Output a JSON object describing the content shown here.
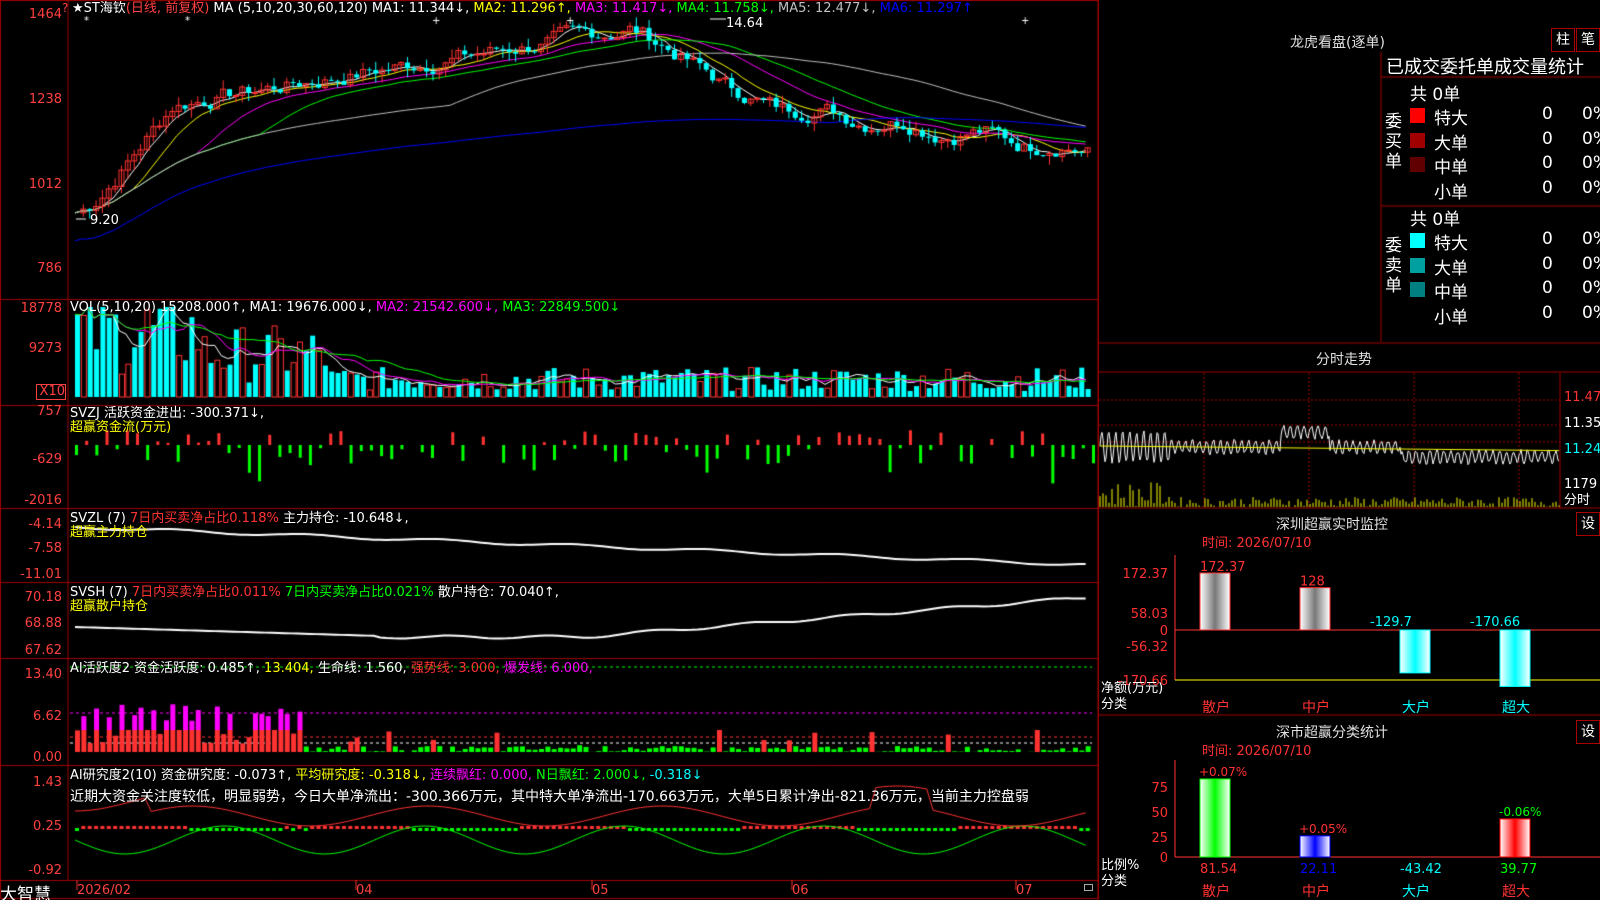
{
  "app": {
    "name": "大智慧"
  },
  "colors": {
    "up": "#ff3232",
    "down": "#00ffff",
    "grid": "#a00000",
    "yellow": "#ffff00",
    "magenta": "#ff00ff",
    "green": "#00ff00",
    "white": "#ffffff",
    "blue": "#0000ff",
    "gray": "#c0c0c0"
  },
  "main": {
    "stock_label": "ST海钦",
    "mode": "(日线, 前复权)",
    "ma_params": "MA (5,10,20,30,60,120)",
    "ma_values": [
      {
        "t": "MA1: 11.344↓,",
        "c": "#ffffff"
      },
      {
        "t": "MA2: 11.296↑,",
        "c": "#ffff00"
      },
      {
        "t": "MA3: 11.417↓,",
        "c": "#ff00ff"
      },
      {
        "t": "MA4: 11.758↓,",
        "c": "#00ff00"
      },
      {
        "t": "MA5: 12.477↓,",
        "c": "#c0c0c0"
      },
      {
        "t": "MA6: 11.297↑",
        "c": "#0000ff"
      }
    ],
    "yticks": [
      "1464",
      "1238",
      "1012",
      "786"
    ],
    "high_marker": "14.64",
    "low_marker": "9.20",
    "corner": "?",
    "date_axis": [
      "2026/02",
      "04",
      "05",
      "06",
      "07"
    ]
  },
  "vol": {
    "title": "VOL(5,10,20)",
    "value": "15208.000↑,",
    "mas": [
      {
        "t": "MA1: 19676.000↓,",
        "c": "#ffffff"
      },
      {
        "t": "MA2: 21542.600↓,",
        "c": "#ff00ff"
      },
      {
        "t": "MA3: 22849.500↓",
        "c": "#00ff00"
      }
    ],
    "yticks": [
      "18778",
      "9273"
    ],
    "unit": "X10"
  },
  "svzj": {
    "title": "SVZJ  活跃资金进出: -300.371↓,",
    "sub": "超赢资金流(万元)",
    "yticks": [
      "757",
      "-629",
      "-2016"
    ]
  },
  "svzl": {
    "title": "SVZL (7)",
    "t1": "7日内买卖净占比0.118%",
    "t2": "主力持仓: -10.648↓,",
    "sub": "超赢主力持仓",
    "yticks": [
      "-4.14",
      "-7.58",
      "-11.01"
    ]
  },
  "svsh": {
    "title": "SVSH (7)",
    "t1": "7日内买卖净占比0.011%",
    "t2": "7日内买卖净占比0.021%",
    "t3": "散户持仓: 70.040↑,",
    "sub": "超赢散户持仓",
    "yticks": [
      "70.18",
      "68.88",
      "67.62"
    ]
  },
  "ai1": {
    "title": "AI活跃度2",
    "t1": "资金活跃度: 0.485↑,",
    "t2": "13.404,",
    "t3": "生命线: 1.560,",
    "t4": "强势线: 3.000,",
    "t5": "爆发线: 6.000,",
    "yticks": [
      "13.40",
      "6.62",
      "0.00"
    ]
  },
  "ai2": {
    "title": "AI研究度2(10)",
    "t1": "资金研究度: -0.073↑,",
    "t2": "平均研究度: -0.318↓,",
    "t3": "连续飘红: 0.000,",
    "t4": "N日飘红: 2.000↓,",
    "t5": "-0.318↓",
    "comment": "近期大资金关注度较低，明显弱势，今日大单净流出：-300.366万元，其中特大单净流出-170.663万元，大单5日累计净出-821.36万元，当前主力控盘弱",
    "yticks": [
      "1.43",
      "0.25",
      "-0.92"
    ]
  },
  "dragon": {
    "title": "龙虎看盘(逐单)",
    "btn1": "柱",
    "btn2": "笔",
    "subtitle": "已成交委托单成交量统计",
    "buy": {
      "label": "委买单",
      "total": "共 0单",
      "rows": [
        {
          "n": "特大",
          "v": "0",
          "p": "0%",
          "c": "#ff0000"
        },
        {
          "n": "大单",
          "v": "0",
          "p": "0%",
          "c": "#a00000"
        },
        {
          "n": "中单",
          "v": "0",
          "p": "0%",
          "c": "#600000"
        },
        {
          "n": "小单",
          "v": "0",
          "p": "0%",
          "c": "#000000"
        }
      ]
    },
    "sell": {
      "label": "委卖单",
      "total": "共 0单",
      "rows": [
        {
          "n": "特大",
          "v": "0",
          "p": "0%",
          "c": "#00ffff"
        },
        {
          "n": "大单",
          "v": "0",
          "p": "0%",
          "c": "#00a0a0"
        },
        {
          "n": "中单",
          "v": "0",
          "p": "0%",
          "c": "#008080"
        },
        {
          "n": "小单",
          "v": "0",
          "p": "0%",
          "c": "#000000"
        }
      ]
    }
  },
  "intraday": {
    "title": "分时走势",
    "yticks": [
      "11.47",
      "11.35",
      "11.24"
    ],
    "vol_label": "1179",
    "fen": "分时"
  },
  "sz_monitor": {
    "title": "深圳超赢实时监控",
    "btn": "设",
    "date": "时间: 2026/07/10",
    "yticks": [
      "172.37",
      "58.03",
      "0",
      "-56.32",
      "-170.66"
    ],
    "ylabel": "净额(万元)",
    "xlabel": "分类",
    "bars": [
      {
        "cat": "散户",
        "v": 172.37,
        "label": "172.37"
      },
      {
        "cat": "中户",
        "v": 128,
        "label": "128"
      },
      {
        "cat": "大户",
        "v": -129.7,
        "label": "-129.7"
      },
      {
        "cat": "超大",
        "v": -170.66,
        "label": "-170.66"
      }
    ]
  },
  "sz_class": {
    "title": "深市超赢分类统计",
    "btn": "设",
    "date": "时间: 2026/07/10",
    "yticks": [
      "75",
      "50",
      "25",
      "0"
    ],
    "ylabel": "比例%",
    "xlabel": "分类",
    "bars": [
      {
        "cat": "散户",
        "top": "+0.07%",
        "bottom": "81.54",
        "v": 81.54,
        "c": "#00ff00",
        "tc": "#ff3232"
      },
      {
        "cat": "中户",
        "top": "+0.05%",
        "bottom": "22.11",
        "v": 22.11,
        "c": "#0000ff",
        "tc": "#ff3232"
      },
      {
        "cat": "大户",
        "top": "",
        "bottom": "-43.42",
        "v": 0,
        "c": "#00ffff",
        "tc": "#00ffff"
      },
      {
        "cat": "超大",
        "top": "-0.06%",
        "bottom": "39.77",
        "v": 39.77,
        "c": "#ff0000",
        "tc": "#00ff00"
      }
    ]
  }
}
